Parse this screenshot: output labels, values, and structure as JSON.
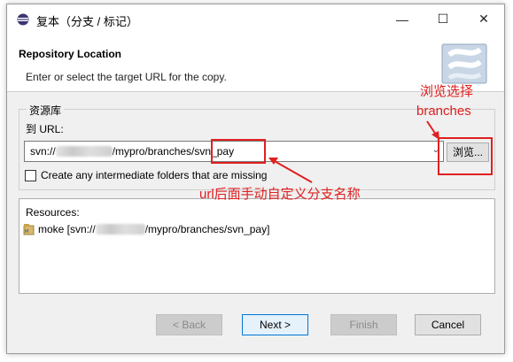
{
  "window": {
    "title": "复本（分支 / 标记）",
    "controls": {
      "minimize": "—",
      "maximize": "☐",
      "close": "✕"
    }
  },
  "header": {
    "title": "Repository Location",
    "description": "Enter or select the target URL for the copy."
  },
  "repository": {
    "group_label": "资源库",
    "url_label": "到 URL:",
    "url_prefix": "svn://",
    "url_middle": "/mypro/branches/",
    "url_suffix": "svn_pay",
    "browse_label": "浏览...",
    "checkbox_label": "Create any intermediate folders that are missing",
    "checkbox_checked": false
  },
  "resources": {
    "label": "Resources:",
    "items": [
      {
        "prefix": "moke [svn://",
        "suffix": "/mypro/branches/svn_pay]"
      }
    ]
  },
  "buttons": {
    "back": "< Back",
    "next": "Next >",
    "finish": "Finish",
    "cancel": "Cancel"
  },
  "annotations": {
    "browse_note_line1": "浏览选择",
    "browse_note_line2": "branches",
    "url_note": "url后面手动自定义分支名称"
  },
  "colors": {
    "annotation": "#e02020",
    "accent": "#0078d7"
  }
}
